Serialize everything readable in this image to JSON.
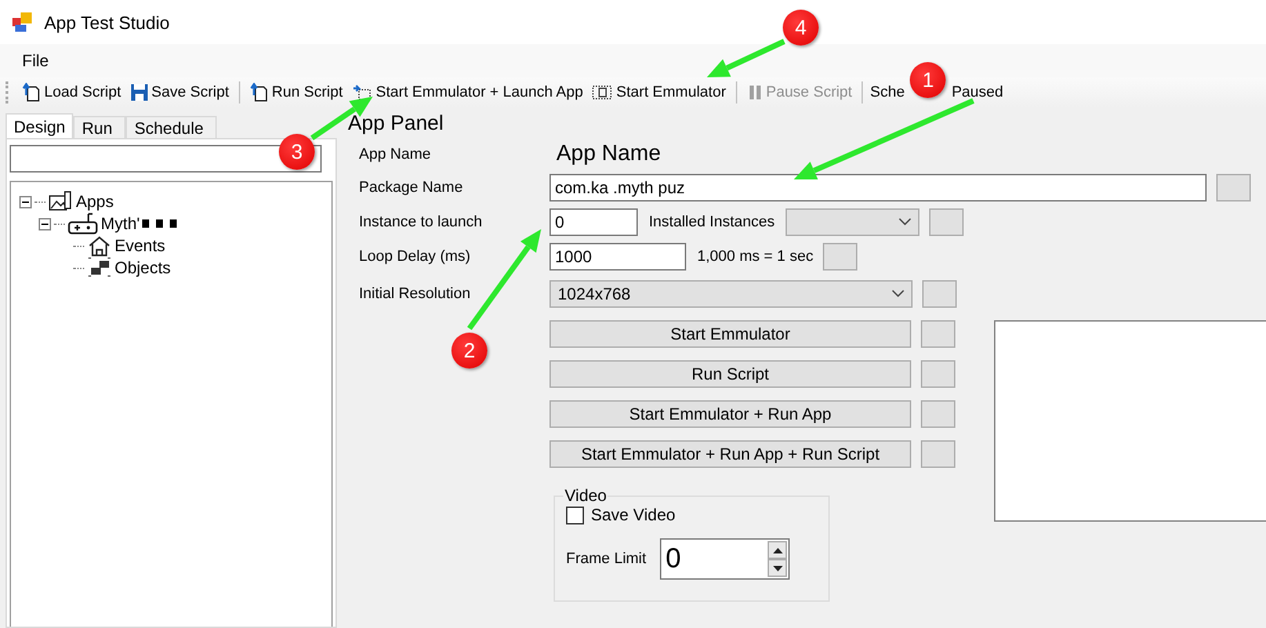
{
  "window": {
    "title": "App Test Studio"
  },
  "menu": [
    "File"
  ],
  "toolbar": [
    {
      "kind": "button",
      "label": "Load Script",
      "disabled": false
    },
    {
      "kind": "button",
      "label": "Save Script",
      "disabled": false
    },
    {
      "kind": "separator"
    },
    {
      "kind": "button",
      "label": "Run Script",
      "disabled": false
    },
    {
      "kind": "button",
      "label": "Start Emmulator + Launch App",
      "disabled": false
    },
    {
      "kind": "button",
      "label": "Start Emmulator",
      "disabled": false
    },
    {
      "kind": "separator"
    },
    {
      "kind": "button",
      "label": "Pause Script",
      "disabled": true
    },
    {
      "kind": "separator"
    },
    {
      "kind": "status",
      "parts": [
        "Sche",
        "Paused"
      ]
    }
  ],
  "tabs": [
    {
      "label": "Design",
      "selected": true
    },
    {
      "label": "Run",
      "selected": false
    },
    {
      "label": "Schedule",
      "selected": false
    }
  ],
  "tree": [
    {
      "label": "Apps",
      "expanded": true,
      "children": [
        {
          "label": "Myth'",
          "redacted": true,
          "expanded": true,
          "children": [
            {
              "label": "Events"
            },
            {
              "label": "Objects"
            }
          ]
        }
      ]
    }
  ],
  "panel": {
    "title": "App Panel",
    "app_name": {
      "label": "App Name",
      "value": "App Name"
    },
    "package_name": {
      "label": "Package Name",
      "value": "com.ka .myth puz"
    },
    "instance": {
      "label": "Instance to launch",
      "value": "0",
      "installed_label": "Installed Instances"
    },
    "loop_delay": {
      "label": "Loop Delay (ms)",
      "value": "1000",
      "hint": "1,000 ms = 1 sec"
    },
    "resolution": {
      "label": "Initial Resolution",
      "value": "1024x768"
    },
    "buttons": [
      "Start Emmulator",
      "Run Script",
      "Start Emmulator + Run App",
      "Start Emmulator + Run App + Run Script"
    ],
    "video": {
      "title": "Video",
      "save_video": {
        "label": "Save Video",
        "checked": false
      },
      "frame_limit": {
        "label": "Frame Limit",
        "value": "0"
      }
    }
  },
  "annotations": [
    {
      "number": "1"
    },
    {
      "number": "2"
    },
    {
      "number": "3"
    },
    {
      "number": "4"
    }
  ]
}
